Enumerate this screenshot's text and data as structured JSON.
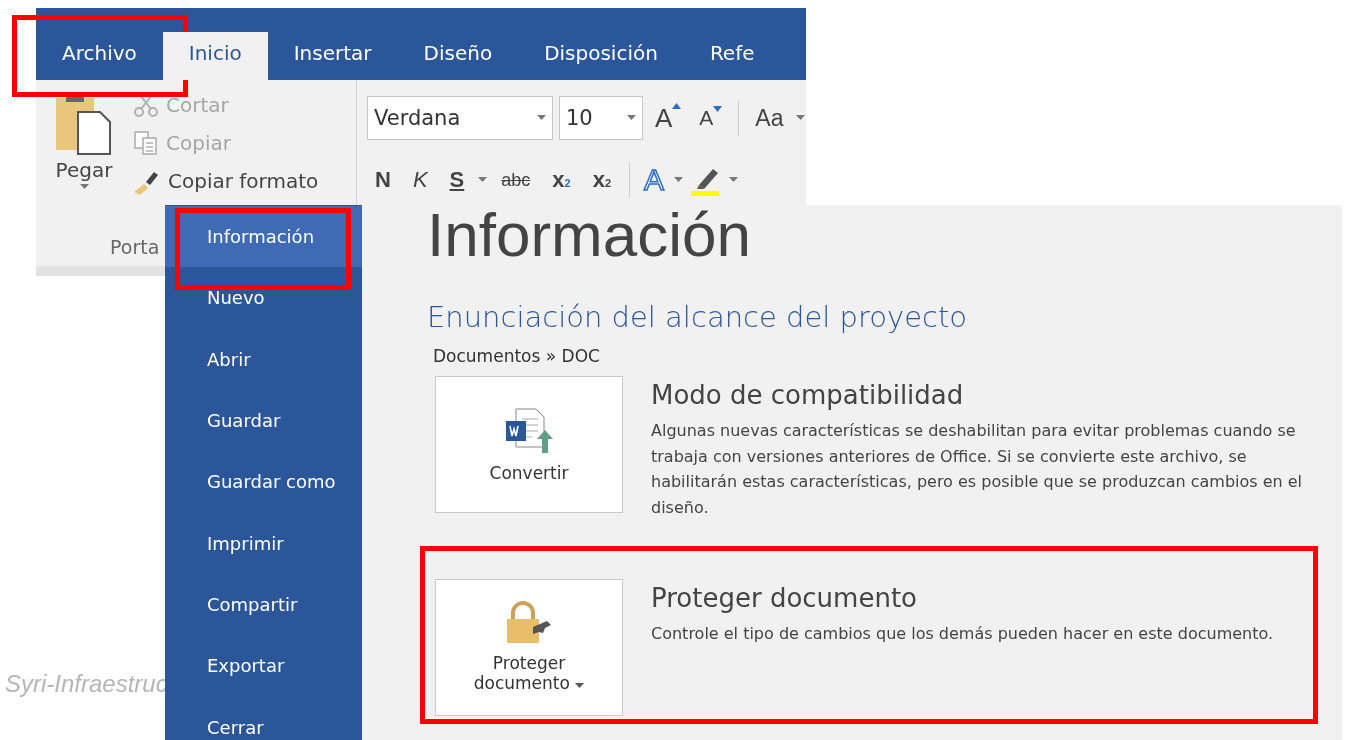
{
  "background_text": "Syri-Infraestruc",
  "ribbon": {
    "tabs": [
      {
        "label": "Archivo",
        "selected": false,
        "highlighted": true
      },
      {
        "label": "Inicio",
        "selected": true,
        "highlighted": false
      },
      {
        "label": "Insertar",
        "selected": false,
        "highlighted": false
      },
      {
        "label": "Diseño",
        "selected": false,
        "highlighted": false
      },
      {
        "label": "Disposición",
        "selected": false,
        "highlighted": false
      },
      {
        "label": "Refe",
        "selected": false,
        "highlighted": false
      }
    ],
    "clipboard": {
      "paste": "Pegar",
      "actions": [
        {
          "kind": "cut",
          "label": "Cortar",
          "disabled": true
        },
        {
          "kind": "copy",
          "label": "Copiar",
          "disabled": true
        },
        {
          "kind": "painter",
          "label": "Copiar formato",
          "disabled": false
        }
      ],
      "group_label": "Porta"
    },
    "font": {
      "name": "Verdana",
      "size": "10",
      "grow": "A",
      "shrink": "A",
      "change_case": "Aa",
      "buttons": [
        {
          "kind": "bold",
          "label": "N",
          "dropdown": false
        },
        {
          "kind": "italic",
          "label": "K",
          "dropdown": false
        },
        {
          "kind": "underline",
          "label": "S",
          "dropdown": true
        },
        {
          "kind": "strike",
          "label": "abc",
          "dropdown": false
        },
        {
          "kind": "subscript",
          "label": "x",
          "index": "2",
          "dropdown": false
        },
        {
          "kind": "superscript",
          "label": "x",
          "index": "2",
          "dropdown": false
        },
        {
          "kind": "effects",
          "label": "A",
          "dropdown": true
        },
        {
          "kind": "highlight",
          "dropdown": true
        }
      ]
    }
  },
  "backstage": {
    "nav": [
      {
        "label": "Información",
        "selected": true,
        "highlighted": true
      },
      {
        "label": "Nuevo",
        "selected": false,
        "highlighted": false
      },
      {
        "label": "Abrir",
        "selected": false,
        "highlighted": false
      },
      {
        "label": "Guardar",
        "selected": false,
        "highlighted": false
      },
      {
        "label": "Guardar como",
        "selected": false,
        "highlighted": false
      },
      {
        "label": "Imprimir",
        "selected": false,
        "highlighted": false
      },
      {
        "label": "Compartir",
        "selected": false,
        "highlighted": false
      },
      {
        "label": "Exportar",
        "selected": false,
        "highlighted": false
      },
      {
        "label": "Cerrar",
        "selected": false,
        "highlighted": false
      }
    ],
    "title": "Información",
    "document_title": "Enunciación del alcance del proyecto",
    "path": "Documentos » DOC",
    "sections": [
      {
        "kind": "convert",
        "button": "Convertir",
        "dropdown": false,
        "heading": "Modo de compatibilidad",
        "description": "Algunas nuevas características se deshabilitan para evitar problemas cuando se trabaja con versiones anteriores de Office. Si se convierte este archivo, se habilitarán estas características, pero es posible que se produzcan cambios en el diseño.",
        "highlighted": false
      },
      {
        "kind": "protect",
        "button": "Proteger documento",
        "dropdown": true,
        "heading": "Proteger documento",
        "description": "Controle el tipo de cambios que los demás pueden hacer en este documento.",
        "highlighted": true
      }
    ]
  }
}
